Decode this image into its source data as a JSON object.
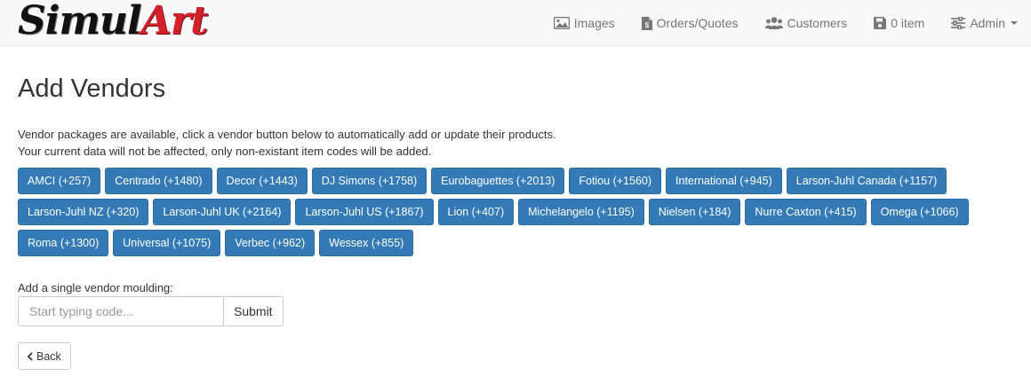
{
  "brand": {
    "part1": "Simul",
    "part2": "Art"
  },
  "nav": {
    "images": {
      "label": "Images",
      "icon": "image-icon"
    },
    "orders": {
      "label": "Orders/Quotes",
      "icon": "document-icon"
    },
    "customers": {
      "label": "Customers",
      "icon": "users-icon"
    },
    "cart": {
      "label": "0 item",
      "icon": "save-icon"
    },
    "admin": {
      "label": "Admin",
      "icon": "sliders-icon"
    }
  },
  "page": {
    "title": "Add Vendors",
    "desc_line1": "Vendor packages are available, click a vendor button below to automatically add or update their products.",
    "desc_line2": "Your current data will not be affected, only non-existant item codes will be added."
  },
  "vendors": [
    "AMCI (+257)",
    "Centrado (+1480)",
    "Decor (+1443)",
    "DJ Simons (+1758)",
    "Eurobaguettes (+2013)",
    "Fotiou (+1560)",
    "International (+945)",
    "Larson-Juhl Canada (+1157)",
    "Larson-Juhl NZ (+320)",
    "Larson-Juhl UK (+2164)",
    "Larson-Juhl US (+1867)",
    "Lion (+407)",
    "Michelangelo (+1195)",
    "Nielsen (+184)",
    "Nurre Caxton (+415)",
    "Omega (+1066)",
    "Roma (+1300)",
    "Universal (+1075)",
    "Verbec (+962)",
    "Wessex (+855)"
  ],
  "single": {
    "label": "Add a single vendor moulding:",
    "placeholder": "Start typing code...",
    "value": "",
    "submit_label": "Submit"
  },
  "back": {
    "label": "Back",
    "icon": "chevron-left-icon"
  },
  "colors": {
    "primary": "#337ab7",
    "navbar_bg": "#f8f8f8",
    "brand_red": "#d4202a"
  }
}
